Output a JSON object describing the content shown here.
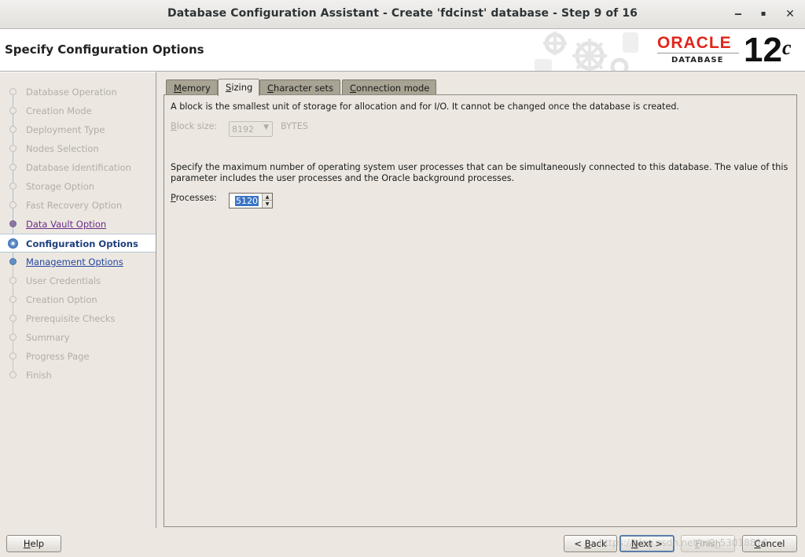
{
  "window": {
    "title": "Database Configuration Assistant - Create 'fdcinst' database - Step 9 of 16",
    "minimize_glyph": "‒",
    "maximize_glyph": "▪",
    "close_glyph": "✕"
  },
  "header": {
    "page_title": "Specify Configuration Options",
    "logo_brand": "ORACLE",
    "logo_product": "DATABASE",
    "logo_version": "12",
    "logo_version_suffix": "c"
  },
  "sidebar": {
    "steps": [
      {
        "label": "Database Operation",
        "state": "inactive"
      },
      {
        "label": "Creation Mode",
        "state": "inactive"
      },
      {
        "label": "Deployment Type",
        "state": "inactive"
      },
      {
        "label": "Nodes Selection",
        "state": "inactive"
      },
      {
        "label": "Database Identification",
        "state": "inactive"
      },
      {
        "label": "Storage Option",
        "state": "inactive"
      },
      {
        "label": "Fast Recovery Option",
        "state": "inactive"
      },
      {
        "label": "Data Vault Option",
        "state": "visited"
      },
      {
        "label": "Configuration Options",
        "state": "current"
      },
      {
        "label": "Management Options",
        "state": "link"
      },
      {
        "label": "User Credentials",
        "state": "inactive"
      },
      {
        "label": "Creation Option",
        "state": "inactive"
      },
      {
        "label": "Prerequisite Checks",
        "state": "inactive"
      },
      {
        "label": "Summary",
        "state": "inactive"
      },
      {
        "label": "Progress Page",
        "state": "inactive"
      },
      {
        "label": "Finish",
        "state": "inactive"
      }
    ]
  },
  "tabs": {
    "memory": {
      "mnemonic": "M",
      "rest": "emory"
    },
    "sizing": {
      "mnemonic": "S",
      "rest": "izing"
    },
    "character_sets": {
      "mnemonic": "C",
      "rest": "haracter sets"
    },
    "connection_mode": {
      "mnemonic": "C",
      "rest": "onnection mode"
    },
    "active": "Sizing"
  },
  "sizing": {
    "block_description": "A block is the smallest unit of storage for allocation and for I/O. It cannot be changed once the database is created.",
    "block_size_label_mnemonic": "B",
    "block_size_label_rest": "lock size:",
    "block_size_value": "8192",
    "block_size_unit": "BYTES",
    "processes_description": "Specify the maximum number of operating system user processes that can be simultaneously connected to this database. The value of this parameter includes the user processes and the Oracle background processes.",
    "processes_label_mnemonic": "P",
    "processes_label_rest": "rocesses:",
    "processes_value": "5120"
  },
  "buttons": {
    "help": {
      "mnemonic": "H",
      "rest": "elp"
    },
    "back": {
      "prefix": "< ",
      "mnemonic": "B",
      "rest": "ack"
    },
    "next": {
      "mnemonic": "N",
      "rest": "ext >"
    },
    "finish": {
      "mnemonic": "F",
      "rest": "inish"
    },
    "cancel": {
      "mnemonic": "C",
      "rest": "ancel"
    }
  },
  "watermark": "https://blog.csdn.net/m0_53018816",
  "colors": {
    "oracle_red": "#e0261b",
    "current_step": "#1d3f7c",
    "link": "#2546a0",
    "visited": "#6a2c89",
    "selection": "#3b74c4"
  }
}
